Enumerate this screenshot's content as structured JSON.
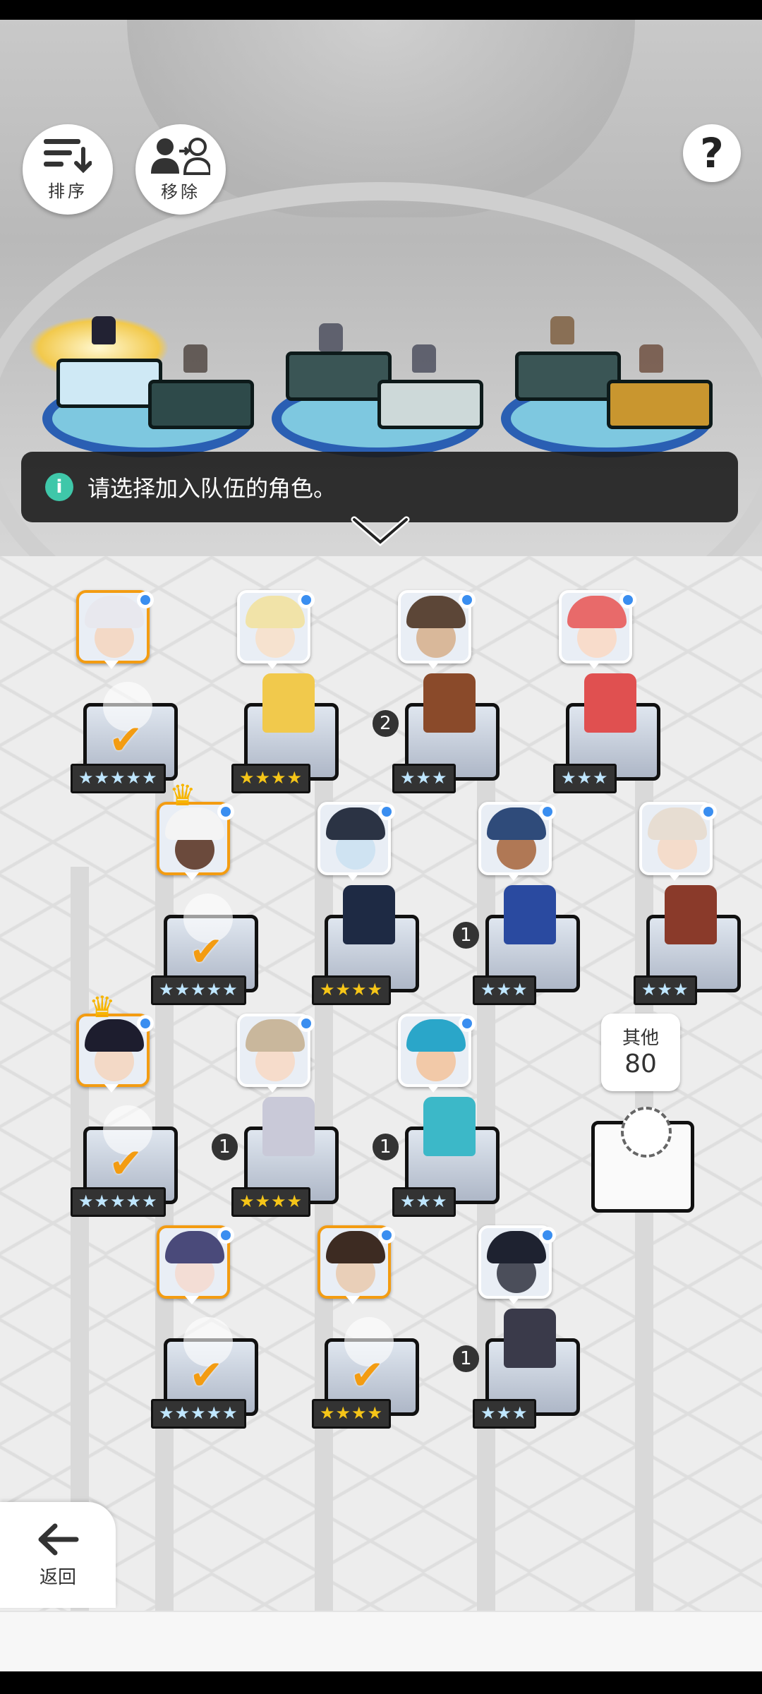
{
  "toolbar": {
    "sort_label": "排序",
    "remove_label": "移除",
    "help_label": "?"
  },
  "banner": {
    "info_symbol": "i",
    "text": "请选择加入队伍的角色。"
  },
  "roster": [
    {
      "stars": "★★★★★",
      "tier": "silver",
      "selected": true,
      "crown": false,
      "count": ""
    },
    {
      "stars": "★★★★",
      "tier": "gold",
      "selected": false,
      "crown": false,
      "count": ""
    },
    {
      "stars": "★★★",
      "tier": "silver",
      "selected": false,
      "crown": false,
      "count": "2"
    },
    {
      "stars": "★★★",
      "tier": "silver",
      "selected": false,
      "crown": false,
      "count": ""
    },
    {
      "stars": "★★★★★",
      "tier": "silver",
      "selected": true,
      "crown": true,
      "count": ""
    },
    {
      "stars": "★★★★",
      "tier": "gold",
      "selected": false,
      "crown": false,
      "count": ""
    },
    {
      "stars": "★★★",
      "tier": "silver",
      "selected": false,
      "crown": false,
      "count": "1"
    },
    {
      "stars": "★★★",
      "tier": "silver",
      "selected": false,
      "crown": false,
      "count": ""
    },
    {
      "stars": "★★★★★",
      "tier": "silver",
      "selected": true,
      "crown": true,
      "count": ""
    },
    {
      "stars": "★★★★",
      "tier": "gold",
      "selected": false,
      "crown": false,
      "count": "1"
    },
    {
      "stars": "★★★",
      "tier": "silver",
      "selected": false,
      "crown": false,
      "count": "1"
    },
    {
      "stars": "★★★★★",
      "tier": "silver",
      "selected": true,
      "crown": false,
      "count": ""
    },
    {
      "stars": "★★★★",
      "tier": "gold",
      "selected": true,
      "crown": false,
      "count": ""
    },
    {
      "stars": "★★★",
      "tier": "silver",
      "selected": false,
      "crown": false,
      "count": "1"
    }
  ],
  "other": {
    "label": "其他",
    "count": "80"
  },
  "back": {
    "label": "返回"
  },
  "colors": {
    "selected_border": "#f39c12",
    "banner_bg": "#1c1c1c",
    "info_icon": "#3fc7a9",
    "star_gold": "#f5c518",
    "star_silver": "#bfe6ff",
    "new_dot": "#3a8ef0",
    "team_ring": "#2a5fb3"
  }
}
